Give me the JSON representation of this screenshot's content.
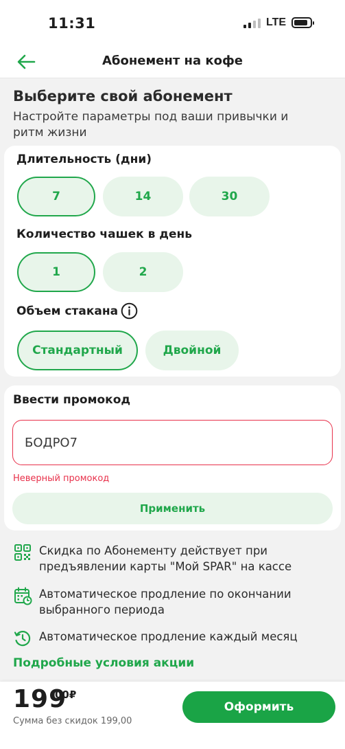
{
  "status_bar": {
    "time": "11:31",
    "network": "LTE"
  },
  "nav": {
    "title": "Абонемент на кофе",
    "back_icon": "arrow-left-icon"
  },
  "intro": {
    "title": "Выберите свой абонемент",
    "subtitle": "Настройте параметры под ваши привычки и ритм жизни"
  },
  "duration": {
    "label": "Длительность (дни)",
    "options": [
      "7",
      "14",
      "30"
    ],
    "selected": "7"
  },
  "cups": {
    "label": "Количество чашек в день",
    "options": [
      "1",
      "2"
    ],
    "selected": "1"
  },
  "volume": {
    "label": "Объем стакана",
    "info_icon": "info-icon",
    "options": [
      "Стандартный",
      "Двойной"
    ],
    "selected": "Стандартный"
  },
  "promo": {
    "label": "Ввести промокод",
    "value": "БОДРО7",
    "error": "Неверный промокод",
    "apply_label": "Применить"
  },
  "info": [
    {
      "icon": "qr-code-icon",
      "text": "Скидка по Абонементу действует при предъявлении карты \"Мой SPAR\" на кассе"
    },
    {
      "icon": "calendar-clock-icon",
      "text": "Автоматическое продление по окончании выбранного периода"
    },
    {
      "icon": "history-icon",
      "text": "Автоматическое продление каждый месяц"
    }
  ],
  "terms_link": "Подробные условия акции",
  "footer": {
    "price_main": "199",
    "price_cents": "00₽",
    "note": "Сумма без скидок 199,00",
    "submit_label": "Оформить"
  },
  "colors": {
    "accent": "#20a74b",
    "accent_light": "#e8f5ea",
    "error": "#e8304a",
    "background": "#f2f2f2"
  }
}
